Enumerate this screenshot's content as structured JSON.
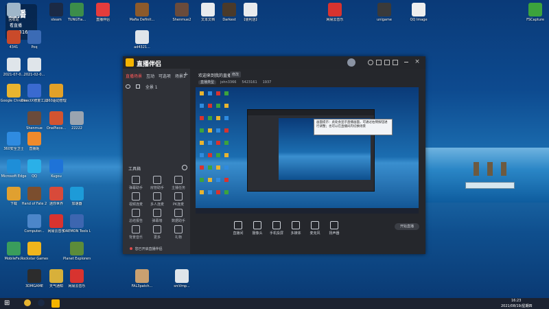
{
  "watermark": {
    "title": "直播",
    "viewers_label": "看直播",
    "count": "5423161"
  },
  "desktop_icons": [
    {
      "label": "回收站",
      "color": "#9fb6c9"
    },
    {
      "label": "4341",
      "color": "#c94a2a"
    },
    {
      "label": "Poq",
      "color": "#3b6bb5"
    },
    {
      "label": "steam",
      "color": "#1b2a45"
    },
    {
      "label": "TUNGTia...",
      "color": "#3c8d4a"
    },
    {
      "label": "直播伴侣",
      "color": "#e63c3c"
    },
    {
      "label": "2021-07-0...",
      "color": "#dfe5ea"
    },
    {
      "label": "2021-02-0...",
      "color": "#dfe5ea"
    },
    {
      "label": "Google Chrome",
      "color": "#e8b430"
    },
    {
      "label": "DirectX修复工具",
      "color": "#3a6ad0"
    },
    {
      "label": "360驱动管理",
      "color": "#e2a128"
    },
    {
      "label": "Shenmue",
      "color": "#6a4b3b"
    },
    {
      "label": "OnePiece...",
      "color": "#d25431"
    },
    {
      "label": "22222",
      "color": "#9aa4b0"
    },
    {
      "label": "360安全卫士",
      "color": "#2f8be0"
    },
    {
      "label": "直播姬",
      "color": "#f08a2b"
    },
    {
      "label": "Microsoft Edge",
      "color": "#1e8ed8"
    },
    {
      "label": "QQ",
      "color": "#2ab0e8"
    },
    {
      "label": "Kugou",
      "color": "#1e73d8"
    },
    {
      "label": "下载",
      "color": "#e0a030"
    },
    {
      "label": "Hand of Fate 2",
      "color": "#7b4e2e"
    },
    {
      "label": "迷你世界",
      "color": "#d84a3a"
    },
    {
      "label": "加速器",
      "color": "#1d9bd8"
    },
    {
      "label": "Computer...",
      "color": "#4c86c9"
    },
    {
      "label": "网易云音乐",
      "color": "#d8332f"
    },
    {
      "label": "DAEMON Tools Lite",
      "color": "#3d66b0"
    },
    {
      "label": "MobileFe...",
      "color": "#3a9d5c"
    },
    {
      "label": "Rockstar Games...",
      "color": "#f1b51c"
    },
    {
      "label": "Planet Explorers",
      "color": "#5c8c3a"
    },
    {
      "label": "3DMGAME",
      "color": "#2c2c2c"
    },
    {
      "label": "天气通知",
      "color": "#d8b03a"
    },
    {
      "label": "网易云音乐",
      "color": "#d8332f"
    },
    {
      "label": "FAL3patch...",
      "color": "#c9a070"
    },
    {
      "label": "ad4321...",
      "color": "#dfe5ea"
    },
    {
      "label": "srcVmp...",
      "color": "#dfe5ea"
    },
    {
      "label": "Mafia Definit...",
      "color": "#8c5a2b"
    },
    {
      "label": "Shenmue2",
      "color": "#6a4b3b"
    },
    {
      "label": "文本文档",
      "color": "#e8ebee"
    },
    {
      "label": "Darkest",
      "color": "#4a3a2a"
    },
    {
      "label": "【便利店】",
      "color": "#e8ebee"
    },
    {
      "label": "网易云音乐",
      "color": "#d8332f"
    },
    {
      "label": "unigame",
      "color": "#3a3a3a"
    },
    {
      "label": "QQ Image",
      "color": "#eeeeee"
    },
    {
      "label": "FSCapture",
      "color": "#3ca33c"
    }
  ],
  "app": {
    "logo_text": "直播伴侣",
    "sidebar_tabs": [
      "直播场景",
      "互动",
      "可选项",
      "场景1"
    ],
    "add_scene": "+",
    "scene_item": "全景 1",
    "tools_title": "工具箱",
    "tools": [
      {
        "label": "弹幕助手"
      },
      {
        "label": "房管助手"
      },
      {
        "label": "主播任务"
      },
      {
        "label": "视频连麦"
      },
      {
        "label": "多人连麦"
      },
      {
        "label": "PK连麦"
      },
      {
        "label": "总结报告"
      },
      {
        "label": "弹幕墙"
      },
      {
        "label": "数据助手"
      },
      {
        "label": "背景音乐"
      },
      {
        "label": "更多"
      },
      {
        "label": "礼物"
      }
    ],
    "sidebar_notice": "您已开启直播伴侣",
    "room_title": "欢迎来到我的直播间",
    "edit_label": "修改",
    "tags": [
      "直播类型",
      "john3366",
      "5423161",
      "1937"
    ],
    "controls": [
      {
        "label": "直播间"
      },
      {
        "label": "摄像头"
      },
      {
        "label": "手机投屏"
      },
      {
        "label": "多媒体"
      },
      {
        "label": "麦克风"
      },
      {
        "label": "扬声器"
      }
    ],
    "start_label": "开始直播",
    "tooltip": "画面提示：此处会显示直播画面，可通过右侧按钮进行调整；也可以在直播间内切换场景"
  },
  "taskbar": {
    "time": "16:23",
    "date": "2021/08/19/星期四"
  }
}
